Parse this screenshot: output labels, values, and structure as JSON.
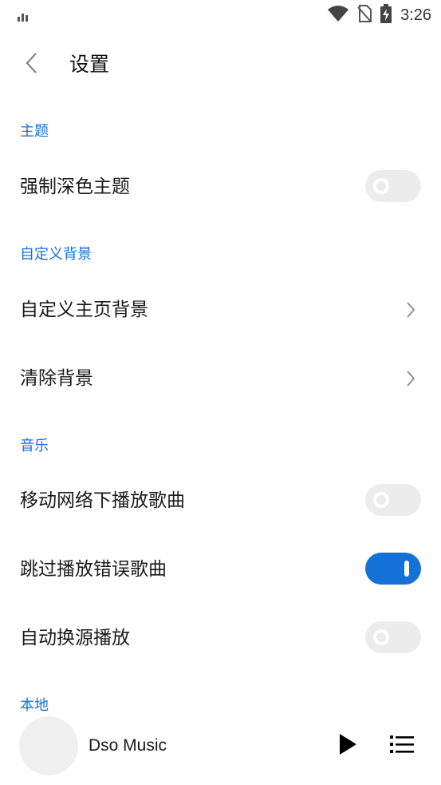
{
  "status_bar": {
    "time": "3:26",
    "icons": [
      "signal-bars-icon",
      "wifi-icon",
      "no-sim-icon",
      "battery-charging-icon"
    ]
  },
  "header": {
    "title": "设置",
    "back_icon": "chevron-left-icon"
  },
  "sections": {
    "theme": {
      "title": "主题",
      "items": [
        {
          "label": "强制深色主题",
          "control": "toggle",
          "enabled": false
        }
      ]
    },
    "custom_background": {
      "title": "自定义背景",
      "items": [
        {
          "label": "自定义主页背景",
          "control": "chevron-right-icon"
        },
        {
          "label": "清除背景",
          "control": "chevron-right-icon"
        }
      ]
    },
    "music": {
      "title": "音乐",
      "items": [
        {
          "label": "移动网络下播放歌曲",
          "control": "toggle",
          "enabled": false
        },
        {
          "label": "跳过播放错误歌曲",
          "control": "toggle",
          "enabled": true
        },
        {
          "label": "自动换源播放",
          "control": "toggle",
          "enabled": false
        }
      ]
    },
    "local": {
      "title": "本地"
    }
  },
  "player": {
    "track_title": "Dso Music",
    "play_icon": "play-icon",
    "playlist_icon": "playlist-icon"
  },
  "colors": {
    "accent": "#1471d8",
    "toggle_off": "#ececec",
    "text": "#1a1a1a"
  }
}
